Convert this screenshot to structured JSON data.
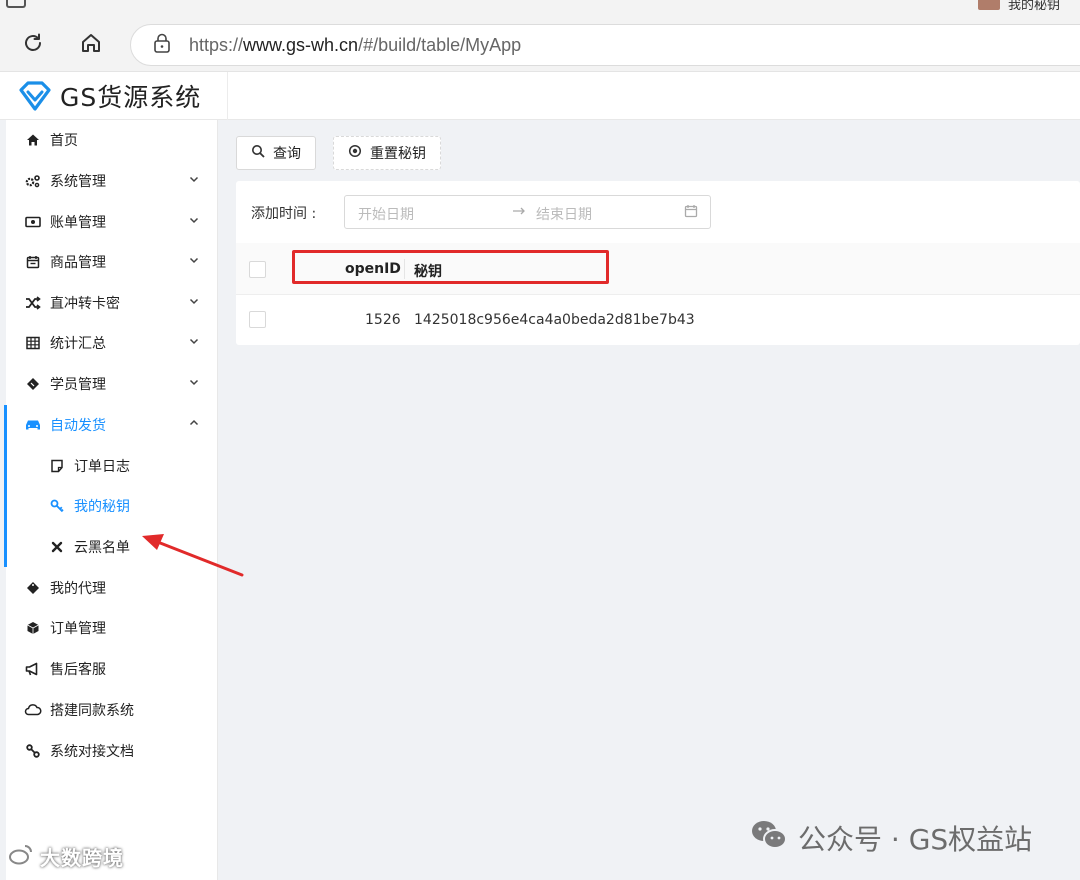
{
  "browser": {
    "profile_name": "我的秘钥",
    "url_prefix": "https://",
    "url_domain": "www.gs-wh.cn",
    "url_path": "/#/build/table/MyApp"
  },
  "app": {
    "title": "GS货源系统"
  },
  "sidebar": {
    "items": [
      {
        "label": "首页"
      },
      {
        "label": "系统管理"
      },
      {
        "label": "账单管理"
      },
      {
        "label": "商品管理"
      },
      {
        "label": "直冲转卡密"
      },
      {
        "label": "统计汇总"
      },
      {
        "label": "学员管理"
      },
      {
        "label": "自动发货"
      },
      {
        "label": "订单日志"
      },
      {
        "label": "我的秘钥"
      },
      {
        "label": "云黑名单"
      },
      {
        "label": "我的代理"
      },
      {
        "label": "订单管理"
      },
      {
        "label": "售后客服"
      },
      {
        "label": "搭建同款系统"
      },
      {
        "label": "系统对接文档"
      }
    ]
  },
  "toolbar": {
    "query_label": "查询",
    "reset_label": "重置秘钥"
  },
  "filter": {
    "label": "添加时间 :",
    "start_placeholder": "开始日期",
    "end_placeholder": "结束日期"
  },
  "table": {
    "columns": [
      "openID",
      "秘钥"
    ],
    "rows": [
      {
        "openid": "1526",
        "key": "1425018c956e4ca4a0beda2d81be7b43"
      }
    ]
  },
  "watermarks": {
    "left": "大数跨境",
    "right": "公众号 · GS权益站"
  },
  "colors": {
    "accent": "#1890ff",
    "highlight": "#e12a2a"
  }
}
